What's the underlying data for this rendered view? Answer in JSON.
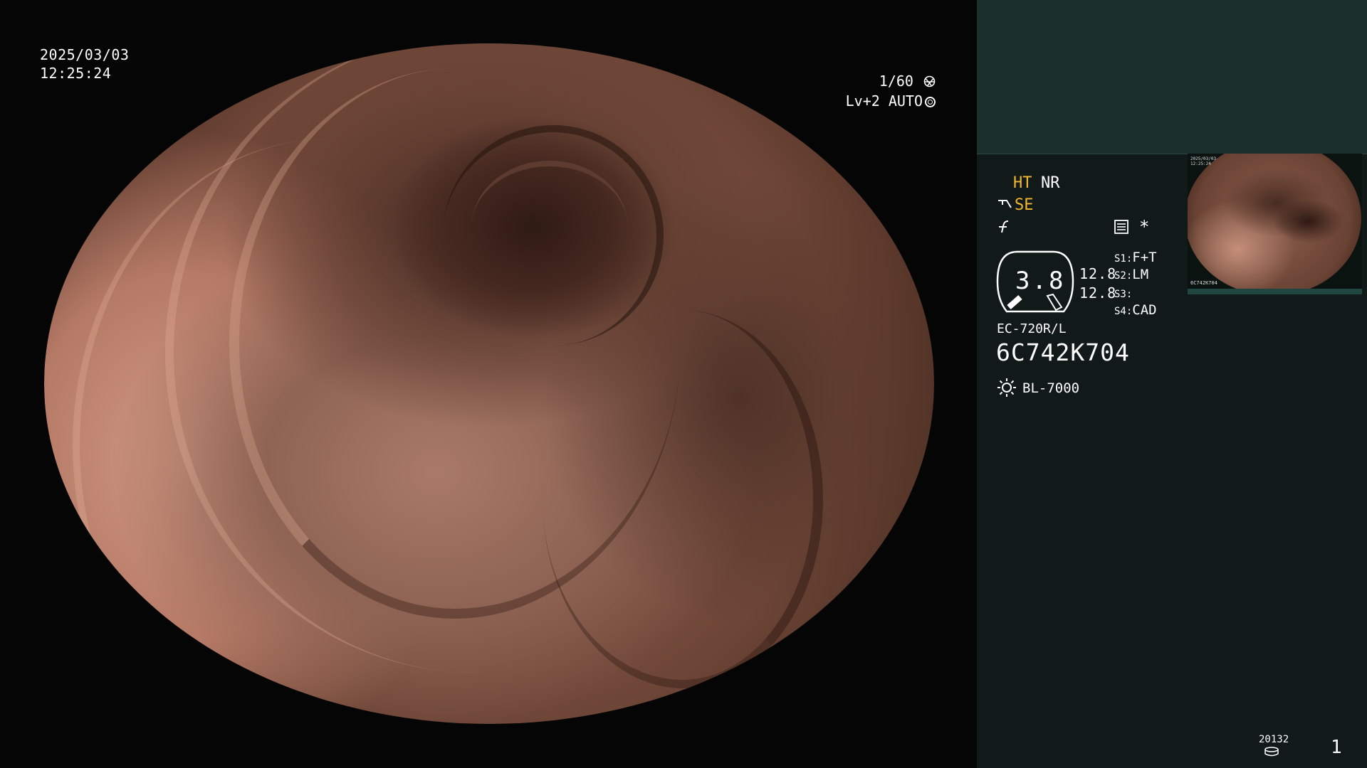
{
  "endoscope_view": {
    "date": "2025/03/03",
    "time": "12:25:24",
    "shutter": "1/60",
    "shutter_icon": "aperture-icon",
    "iris_level": "Lv+2",
    "iris_mode": "AUTO",
    "iris_icon": "iris-ring-icon"
  },
  "info_panel": {
    "colors": {
      "panel_top": "#1a302c",
      "panel": "#111a18",
      "highlight": "#f2b632"
    },
    "ht": "HT",
    "nr": "NR",
    "se": "SE",
    "se_icon": "scope-tip-icon",
    "f_icon": "enhance-icon",
    "list_icon": "list-icon",
    "star": "*",
    "gauge_value": "3.8",
    "value_1": "12.8",
    "value_2": "12.8",
    "slots": [
      {
        "key": "S1",
        "value": "F+T"
      },
      {
        "key": "S2",
        "value": "LM"
      },
      {
        "key": "S3",
        "value": ""
      },
      {
        "key": "S4",
        "value": "CAD"
      }
    ],
    "scope_model": "EC-720R/L",
    "scope_serial": "6C742K704",
    "light_icon": "light-source-icon",
    "light_source": "BL-7000",
    "thumbnail": {
      "date": "2025/03/03",
      "time": "12:25:24",
      "serial": "6C742K704"
    },
    "storage_count": "20132",
    "storage_icon": "storage-icon",
    "page_number": "1"
  }
}
